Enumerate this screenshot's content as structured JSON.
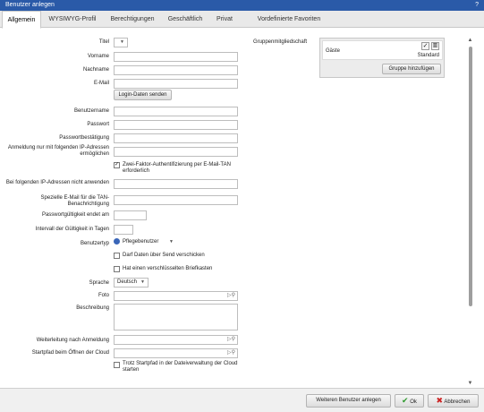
{
  "window": {
    "title": "Benutzer anlegen",
    "help": "?"
  },
  "tabs": [
    "Allgemein",
    "WYSIWYG-Profil",
    "Berechtigungen",
    "Geschäftlich",
    "Privat",
    "Vordefinierte Favoriten"
  ],
  "form": {
    "titel": "Titel",
    "vorname": "Vorname",
    "nachname": "Nachname",
    "email": "E-Mail",
    "login_button": "Login-Daten senden",
    "benutzername": "Benutzername",
    "passwort": "Passwort",
    "passwortbestaetigung": "Passwortbestätigung",
    "ip_login": "Anmeldung nur mit folgenden IP-Adressen ermöglichen",
    "two_factor": "Zwei-Faktor-Authentifizierung per E-Mail-TAN erforderlich",
    "ip_exempt": "Bei folgenden IP-Adressen nicht anwenden",
    "tan_email": "Spezielle E-Mail für die TAN-Benachrichtigung",
    "pw_valid": "Passwortgültigkeit endet am",
    "interval": "Intervall der Gültigkeit in Tagen",
    "benutzertyp": "Benutzertyp",
    "benutzertyp_value": "Pflegebenutzer",
    "send_cb": "Darf Daten über Send verschicken",
    "mailbox_cb": "Hat einen verschlüsselten Briefkasten",
    "sprache": "Sprache",
    "sprache_value": "Deutsch",
    "foto": "Foto",
    "beschreibung": "Beschreibung",
    "redirect": "Weiterleitung nach Anmeldung",
    "startpath": "Startpfad beim Öffnen der Cloud",
    "startpath_cb": "Trotz Startpfad in der Dateiverwaltung der Cloud starten"
  },
  "groups": {
    "label": "Gruppenmitgliedschaft",
    "name": "Gäste",
    "role": "Standard",
    "add_button": "Gruppe hinzufügen"
  },
  "footer": {
    "another": "Weiteren Benutzer anlegen",
    "ok": "Ok",
    "cancel": "Abbrechen"
  },
  "colors": {
    "titlebar": "#2a5aa8",
    "ok_check": "#2e9a2e",
    "cancel_x": "#cc2222"
  }
}
